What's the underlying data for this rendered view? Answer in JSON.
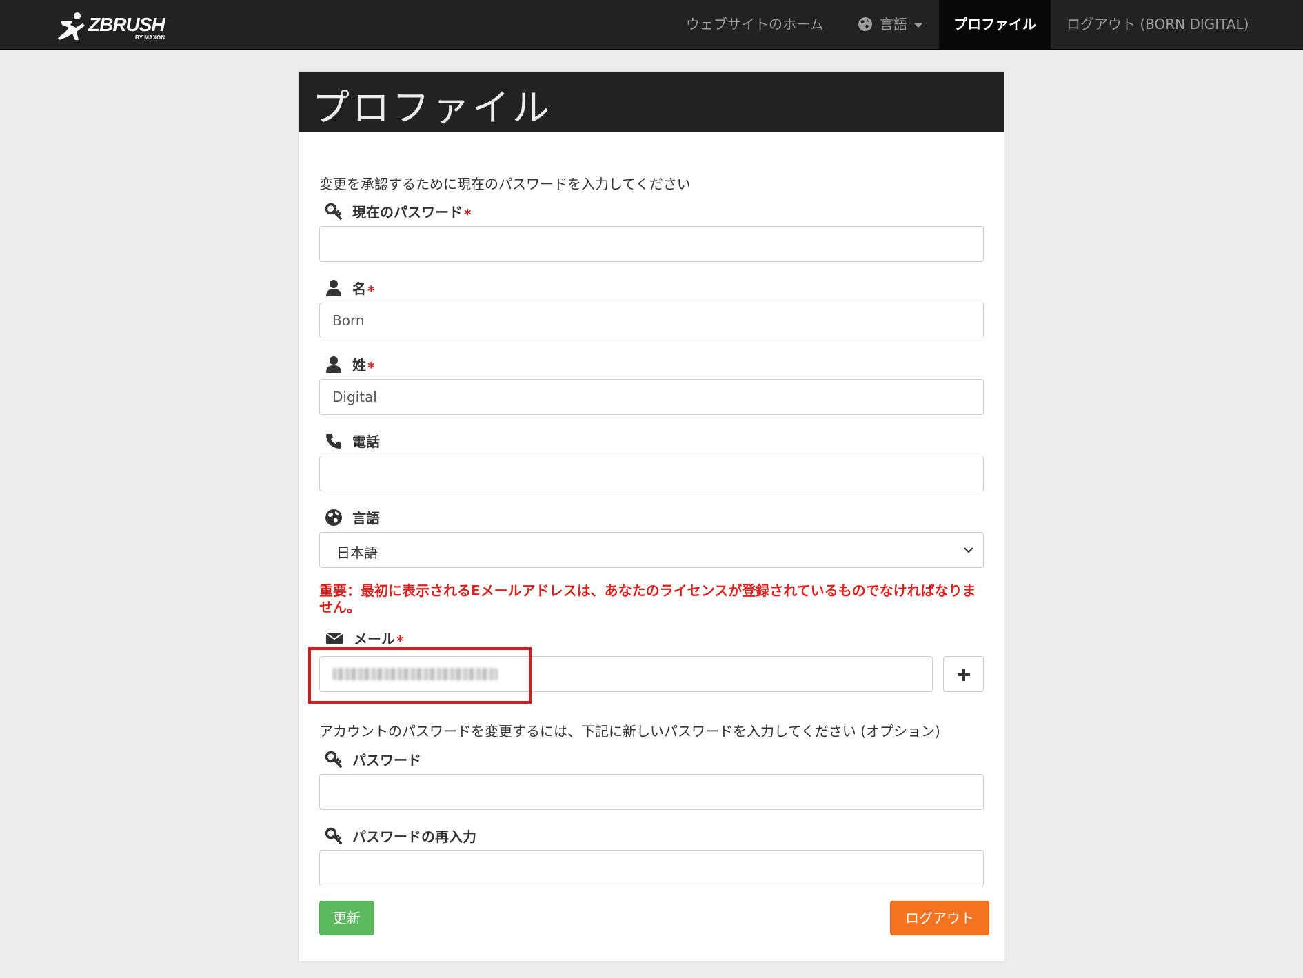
{
  "navbar": {
    "logo_text": "ZBRUSH",
    "logo_sub": "BY MAXON",
    "home_label": "ウェブサイトのホーム",
    "language_label": "言語",
    "profile_label": "プロファイル",
    "logout_label": "ログアウト (BORN DIGITAL)"
  },
  "page": {
    "title": "プロファイル",
    "intro": "変更を承認するために現在のパスワードを入力してください",
    "required_mark": "*"
  },
  "form": {
    "current_password": {
      "label": "現在のパスワード",
      "value": ""
    },
    "first_name": {
      "label": "名",
      "value": "Born"
    },
    "last_name": {
      "label": "姓",
      "value": "Digital"
    },
    "phone": {
      "label": "電話",
      "value": ""
    },
    "language": {
      "label": "言語",
      "selected": "日本語"
    },
    "warning": "重要：最初に表示されるEメールアドレスは、あなたのライセンスが登録されているものでなければなりません。",
    "email": {
      "label": "メール",
      "value_blurred": true
    },
    "password_intro": "アカウントのパスワードを変更するには、下記に新しいパスワードを入力してください (オプション)",
    "new_password": {
      "label": "パスワード",
      "value": ""
    },
    "confirm_password": {
      "label": "パスワードの再入力",
      "value": ""
    },
    "update_label": "更新",
    "logout_label": "ログアウト"
  },
  "colors": {
    "navbar_bg": "#222222",
    "required": "#d9231f",
    "highlight_box": "#d71920",
    "update_button": "#5cb85c",
    "logout_button": "#f47321"
  },
  "icons": [
    "key-icon",
    "user-icon",
    "phone-icon",
    "globe-icon",
    "envelope-icon",
    "plus-icon",
    "chevron-down-icon"
  ]
}
